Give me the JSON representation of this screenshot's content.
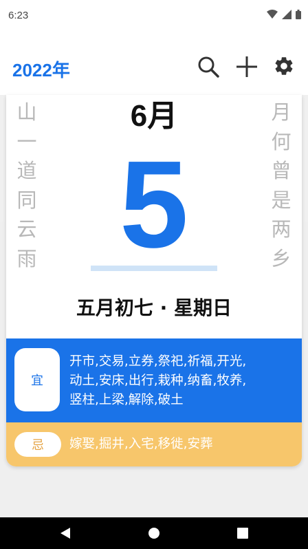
{
  "status_bar": {
    "time": "6:23",
    "icons": [
      "wifi-icon",
      "signal-icon",
      "battery-icon"
    ]
  },
  "app_bar": {
    "title": "2022年",
    "actions": [
      "search-icon",
      "add-icon",
      "gear-icon"
    ]
  },
  "calendar": {
    "month": "6月",
    "day": "5",
    "couplet_left": [
      "山",
      "一",
      "道",
      "同",
      "云",
      "雨"
    ],
    "couplet_right": [
      "月",
      "何",
      "曾",
      "是",
      "两",
      "乡"
    ],
    "lunar_date": "五月初七 · 星期日"
  },
  "yi": {
    "label": "宜",
    "lines": [
      "开市,交易,立券,祭祀,祈福,开光,",
      "动土,安床,出行,栽种,纳畜,牧养,",
      "竖柱,上梁,解除,破土"
    ]
  },
  "ji": {
    "label": "忌",
    "text": "嫁娶,掘井,入宅,移徙,安葬"
  },
  "colors": {
    "accent": "#1a73e8",
    "ji_bg": "#f7c66b",
    "ji_label": "#e5a445",
    "couplet": "#b8b8b8"
  },
  "nav_bar": {
    "buttons": [
      "back-icon",
      "home-icon",
      "recents-icon"
    ]
  }
}
